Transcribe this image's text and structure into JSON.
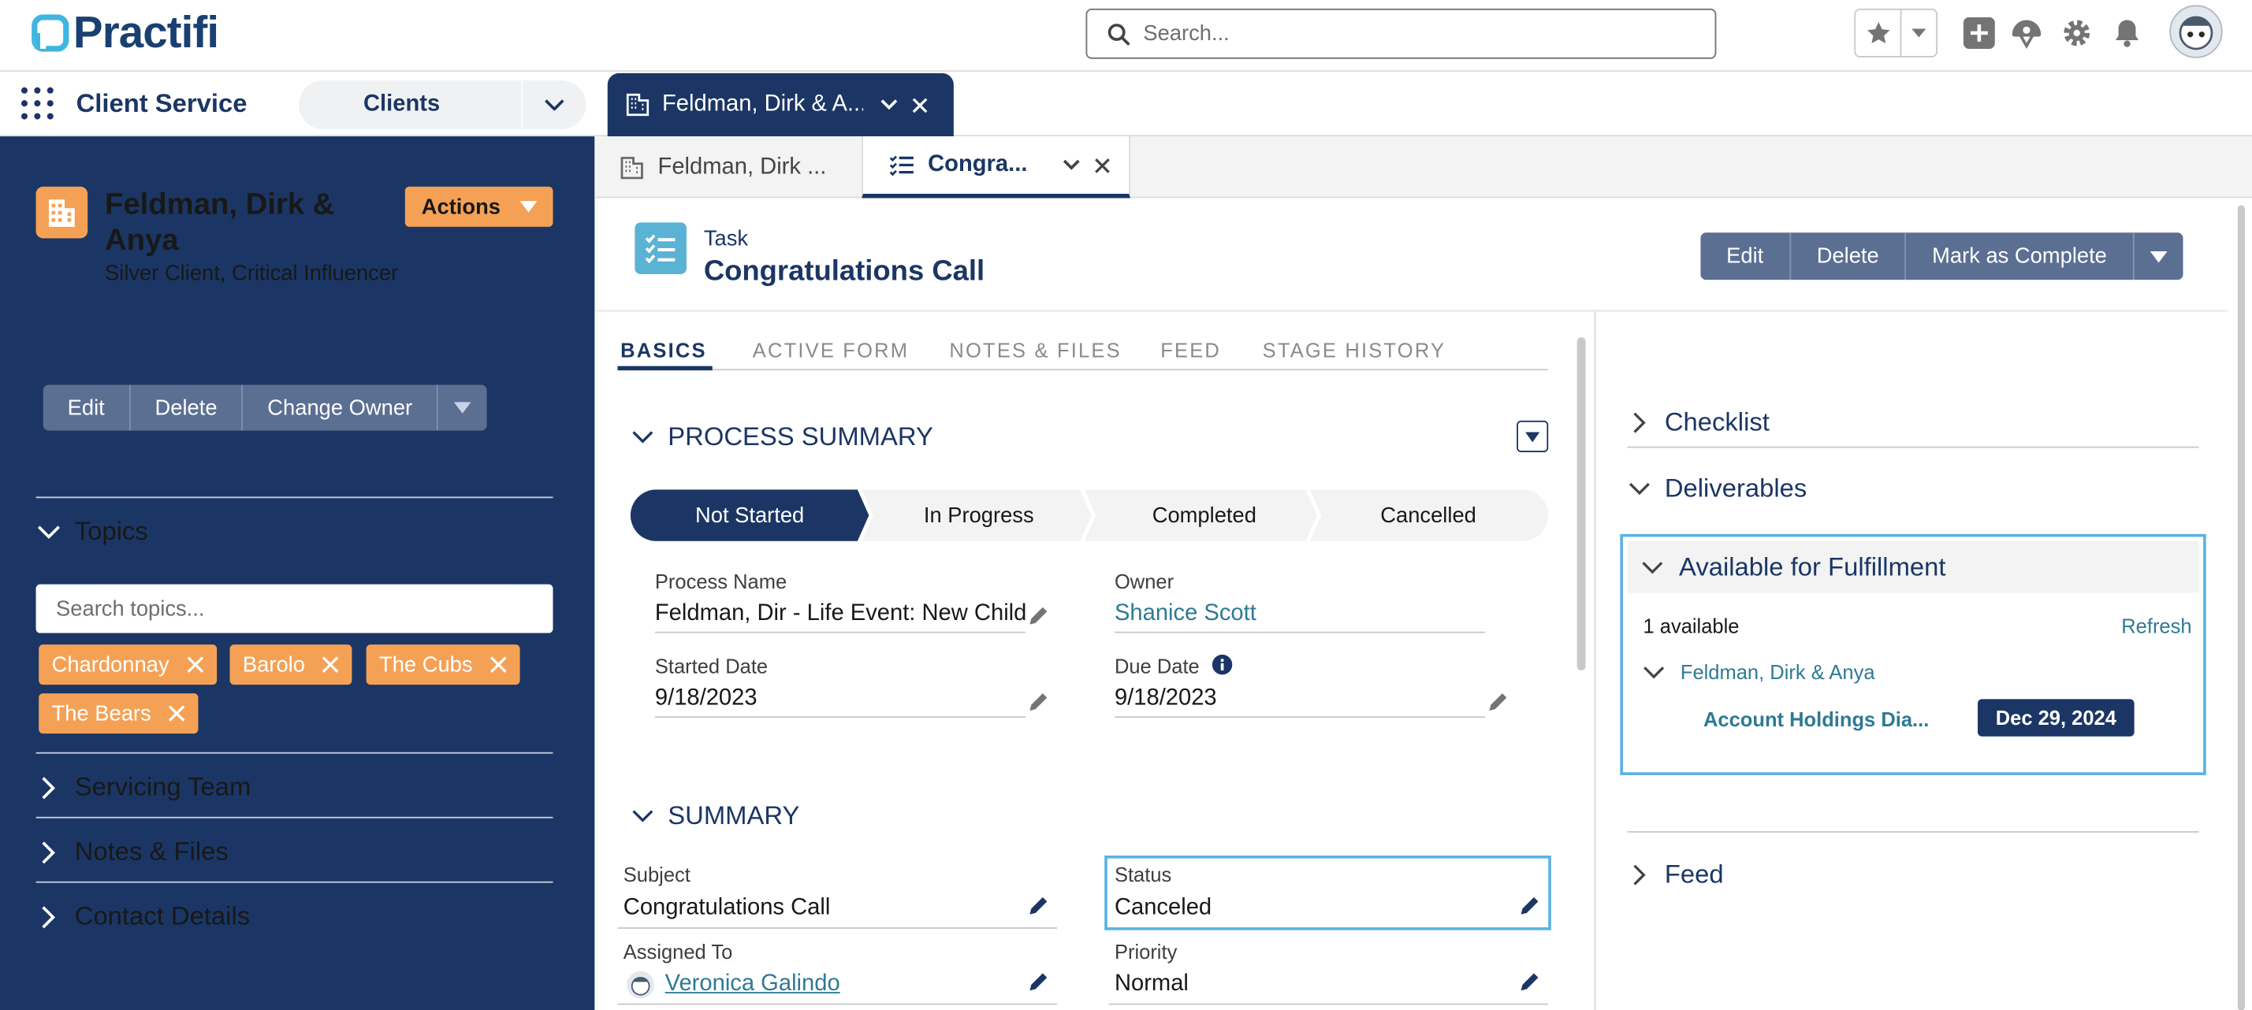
{
  "header": {
    "logo_text": "Practifi",
    "search_placeholder": "Search..."
  },
  "nav": {
    "app_name": "Client Service",
    "object_select": "Clients",
    "workspace_tab": "Feldman, Dirk & A..."
  },
  "account": {
    "name": "Feldman, Dirk & Anya",
    "subtitle": "Silver Client, Critical Influencer",
    "actions_label": "Actions",
    "buttons": [
      "Edit",
      "Delete",
      "Change Owner"
    ],
    "topics": {
      "title": "Topics",
      "search_placeholder": "Search topics...",
      "tags": [
        "Chardonnay",
        "Barolo",
        "The Cubs",
        "The Bears"
      ]
    },
    "sections": [
      "Servicing Team",
      "Notes & Files",
      "Contact Details"
    ]
  },
  "subtabs": [
    {
      "label": "Feldman, Dirk ..."
    },
    {
      "label": "Congra..."
    }
  ],
  "record": {
    "type": "Task",
    "title": "Congratulations Call",
    "buttons": [
      "Edit",
      "Delete",
      "Mark as Complete"
    ]
  },
  "detail_tabs": [
    "BASICS",
    "ACTIVE FORM",
    "NOTES & FILES",
    "FEED",
    "STAGE HISTORY"
  ],
  "process_summary": {
    "title": "PROCESS SUMMARY",
    "path": [
      "Not Started",
      "In Progress",
      "Completed",
      "Cancelled"
    ],
    "fields": {
      "process_name_label": "Process Name",
      "process_name": "Feldman, Dir - Life Event: New Child",
      "owner_label": "Owner",
      "owner": "Shanice Scott",
      "started_label": "Started Date",
      "started": "9/18/2023",
      "due_label": "Due Date",
      "due": "9/18/2023"
    }
  },
  "summary": {
    "title": "SUMMARY",
    "subject_label": "Subject",
    "subject": "Congratulations Call",
    "status_label": "Status",
    "status": "Canceled",
    "assigned_label": "Assigned To",
    "assigned": "Veronica Galindo",
    "priority_label": "Priority",
    "priority": "Normal"
  },
  "right": {
    "checklist": "Checklist",
    "deliverables": "Deliverables",
    "fulfillment": {
      "title": "Available for Fulfillment",
      "count": "1 available",
      "refresh": "Refresh",
      "group": "Feldman, Dirk & Anya",
      "item": "Account Holdings Dia...",
      "date": "Dec 29, 2024"
    },
    "feed": "Feed"
  },
  "colors": {
    "navy": "#1b3664",
    "orange": "#f5a155",
    "accent_blue": "#5ab3e3",
    "link": "#2e7a94"
  }
}
